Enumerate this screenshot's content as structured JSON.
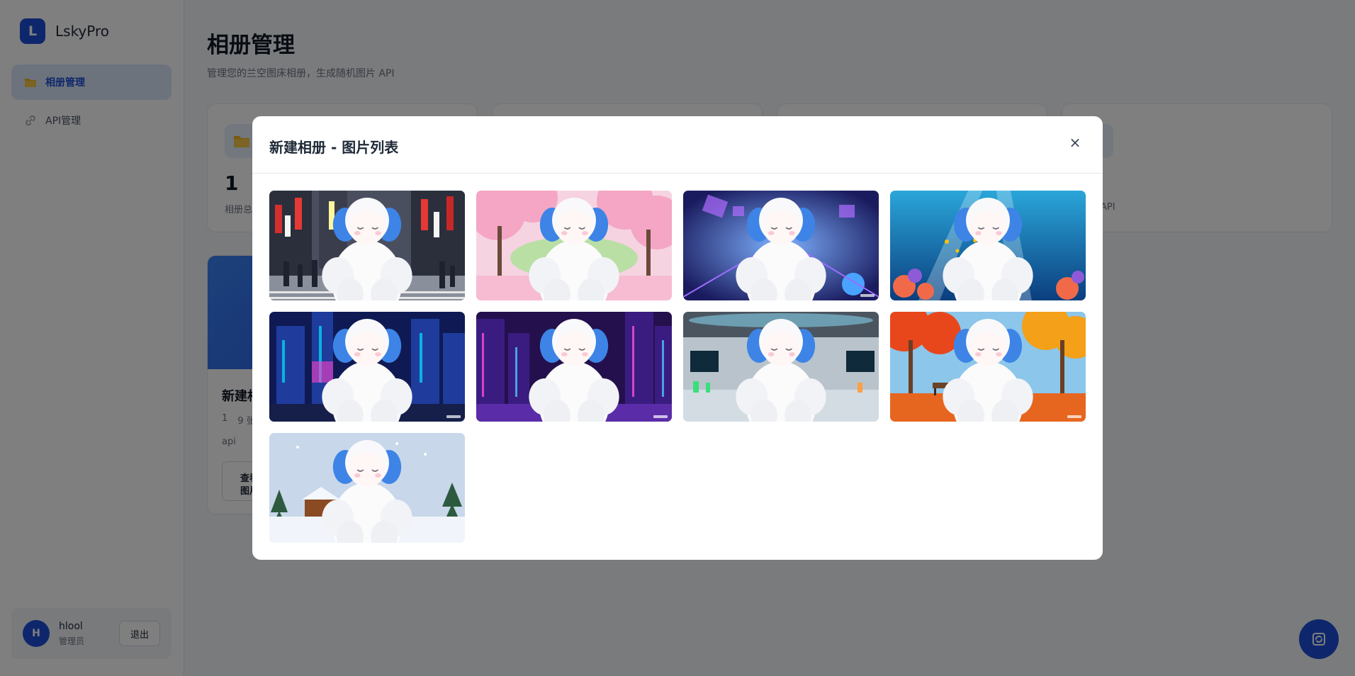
{
  "app": {
    "logo_letter": "L",
    "name": "LskyPro"
  },
  "sidebar": {
    "items": [
      {
        "label": "相册管理",
        "icon": "folder-icon",
        "active": true
      },
      {
        "label": "API管理",
        "icon": "link-icon",
        "active": false
      }
    ]
  },
  "user": {
    "avatar_letter": "H",
    "name": "hlool",
    "role": "管理员",
    "logout_label": "退出"
  },
  "page": {
    "title": "相册管理",
    "subtitle": "管理您的兰空图床相册，生成随机图片 API"
  },
  "stats": [
    {
      "value": "1",
      "label": "相册总",
      "icon": "folder-icon"
    },
    {
      "value": "",
      "label": "",
      "icon": ""
    },
    {
      "value": "",
      "label": "",
      "icon": ""
    },
    {
      "value": "",
      "label": "API",
      "icon": "api-icon"
    }
  ],
  "album_card": {
    "title": "新建相",
    "count": "1",
    "images": "9 张",
    "tag": "api",
    "view_label_1": "查看",
    "view_label_2": "图片"
  },
  "modal": {
    "title": "新建相册 - 图片列表",
    "close_label": "×",
    "images": [
      {
        "scene": "tokyo-street"
      },
      {
        "scene": "cherry-blossom"
      },
      {
        "scene": "cyber-space"
      },
      {
        "scene": "underwater-reef"
      },
      {
        "scene": "neon-city-blue"
      },
      {
        "scene": "neon-city-purple"
      },
      {
        "scene": "sci-fi-lab"
      },
      {
        "scene": "autumn-park"
      },
      {
        "scene": "snowy-cabin"
      }
    ]
  },
  "colors": {
    "accent": "#1d4ed8",
    "overlay": "rgba(0,0,0,0.5)"
  }
}
